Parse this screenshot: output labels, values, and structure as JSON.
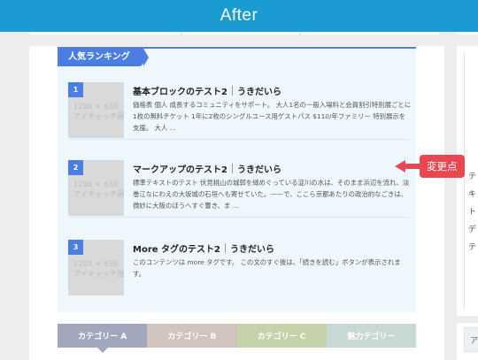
{
  "header": {
    "title": "After"
  },
  "ranking": {
    "tag": "人気ランキング",
    "items": [
      {
        "rank": "1",
        "title": "基本ブロックのテスト2",
        "author": "うきだいら",
        "thumb": "1200 × 630\nアイキャッチ画像",
        "desc": "価格表 個人 成長するコミュニティをサポート。 大人1名の一般入場料と会員割引特別展ごとに1枚の無料チケット 1年に2枚のシングルユース用ゲストパス $110/年ファミリー 特別展示を支援。 大人 ..."
      },
      {
        "rank": "2",
        "title": "マークアップのテスト2",
        "author": "うきだいら",
        "thumb": "1200 × 630\nアイキャッチ画像",
        "desc": "標準テキストのテスト 伏見桃山の城郭を縫めぐっている淀川の水は、そのまま浜辺を流れ、淡巻江なにわえの大坂城の石垣へも寄せていた。——で、ここら京都あたりの政治的なごきは、微妙に大阪のほうへすぐ響き、ま ..."
      },
      {
        "rank": "3",
        "title": "More タグのテスト2",
        "author": "うきだいら",
        "thumb": "1200 × 630\nアイキャッチ画像",
        "desc": "このコンテンツは more タグです。 この文のすぐ後は、「続きを読む」ボタンが表示されます。"
      }
    ]
  },
  "callout": {
    "label": "変更点",
    "color": "#e8474f"
  },
  "tabs": [
    {
      "label": "カテゴリー A",
      "color": "#a2a8bb",
      "active": true
    },
    {
      "label": "カテゴリー B",
      "color": "#d1c3bd",
      "active": false
    },
    {
      "label": "カテゴリー C",
      "color": "#c6d2aa",
      "active": false
    },
    {
      "label": "魅力テゴリー",
      "color": "#c8d8d4",
      "active": false
    }
  ],
  "sidebar": {
    "glyphs": [
      "テ",
      "キ",
      "ト",
      "デ",
      "テ"
    ],
    "box_letter": "ア"
  },
  "colors": {
    "accent": "#4b7de2",
    "header": "#1a9bd1",
    "ranking_bg": "#eef7fd"
  }
}
